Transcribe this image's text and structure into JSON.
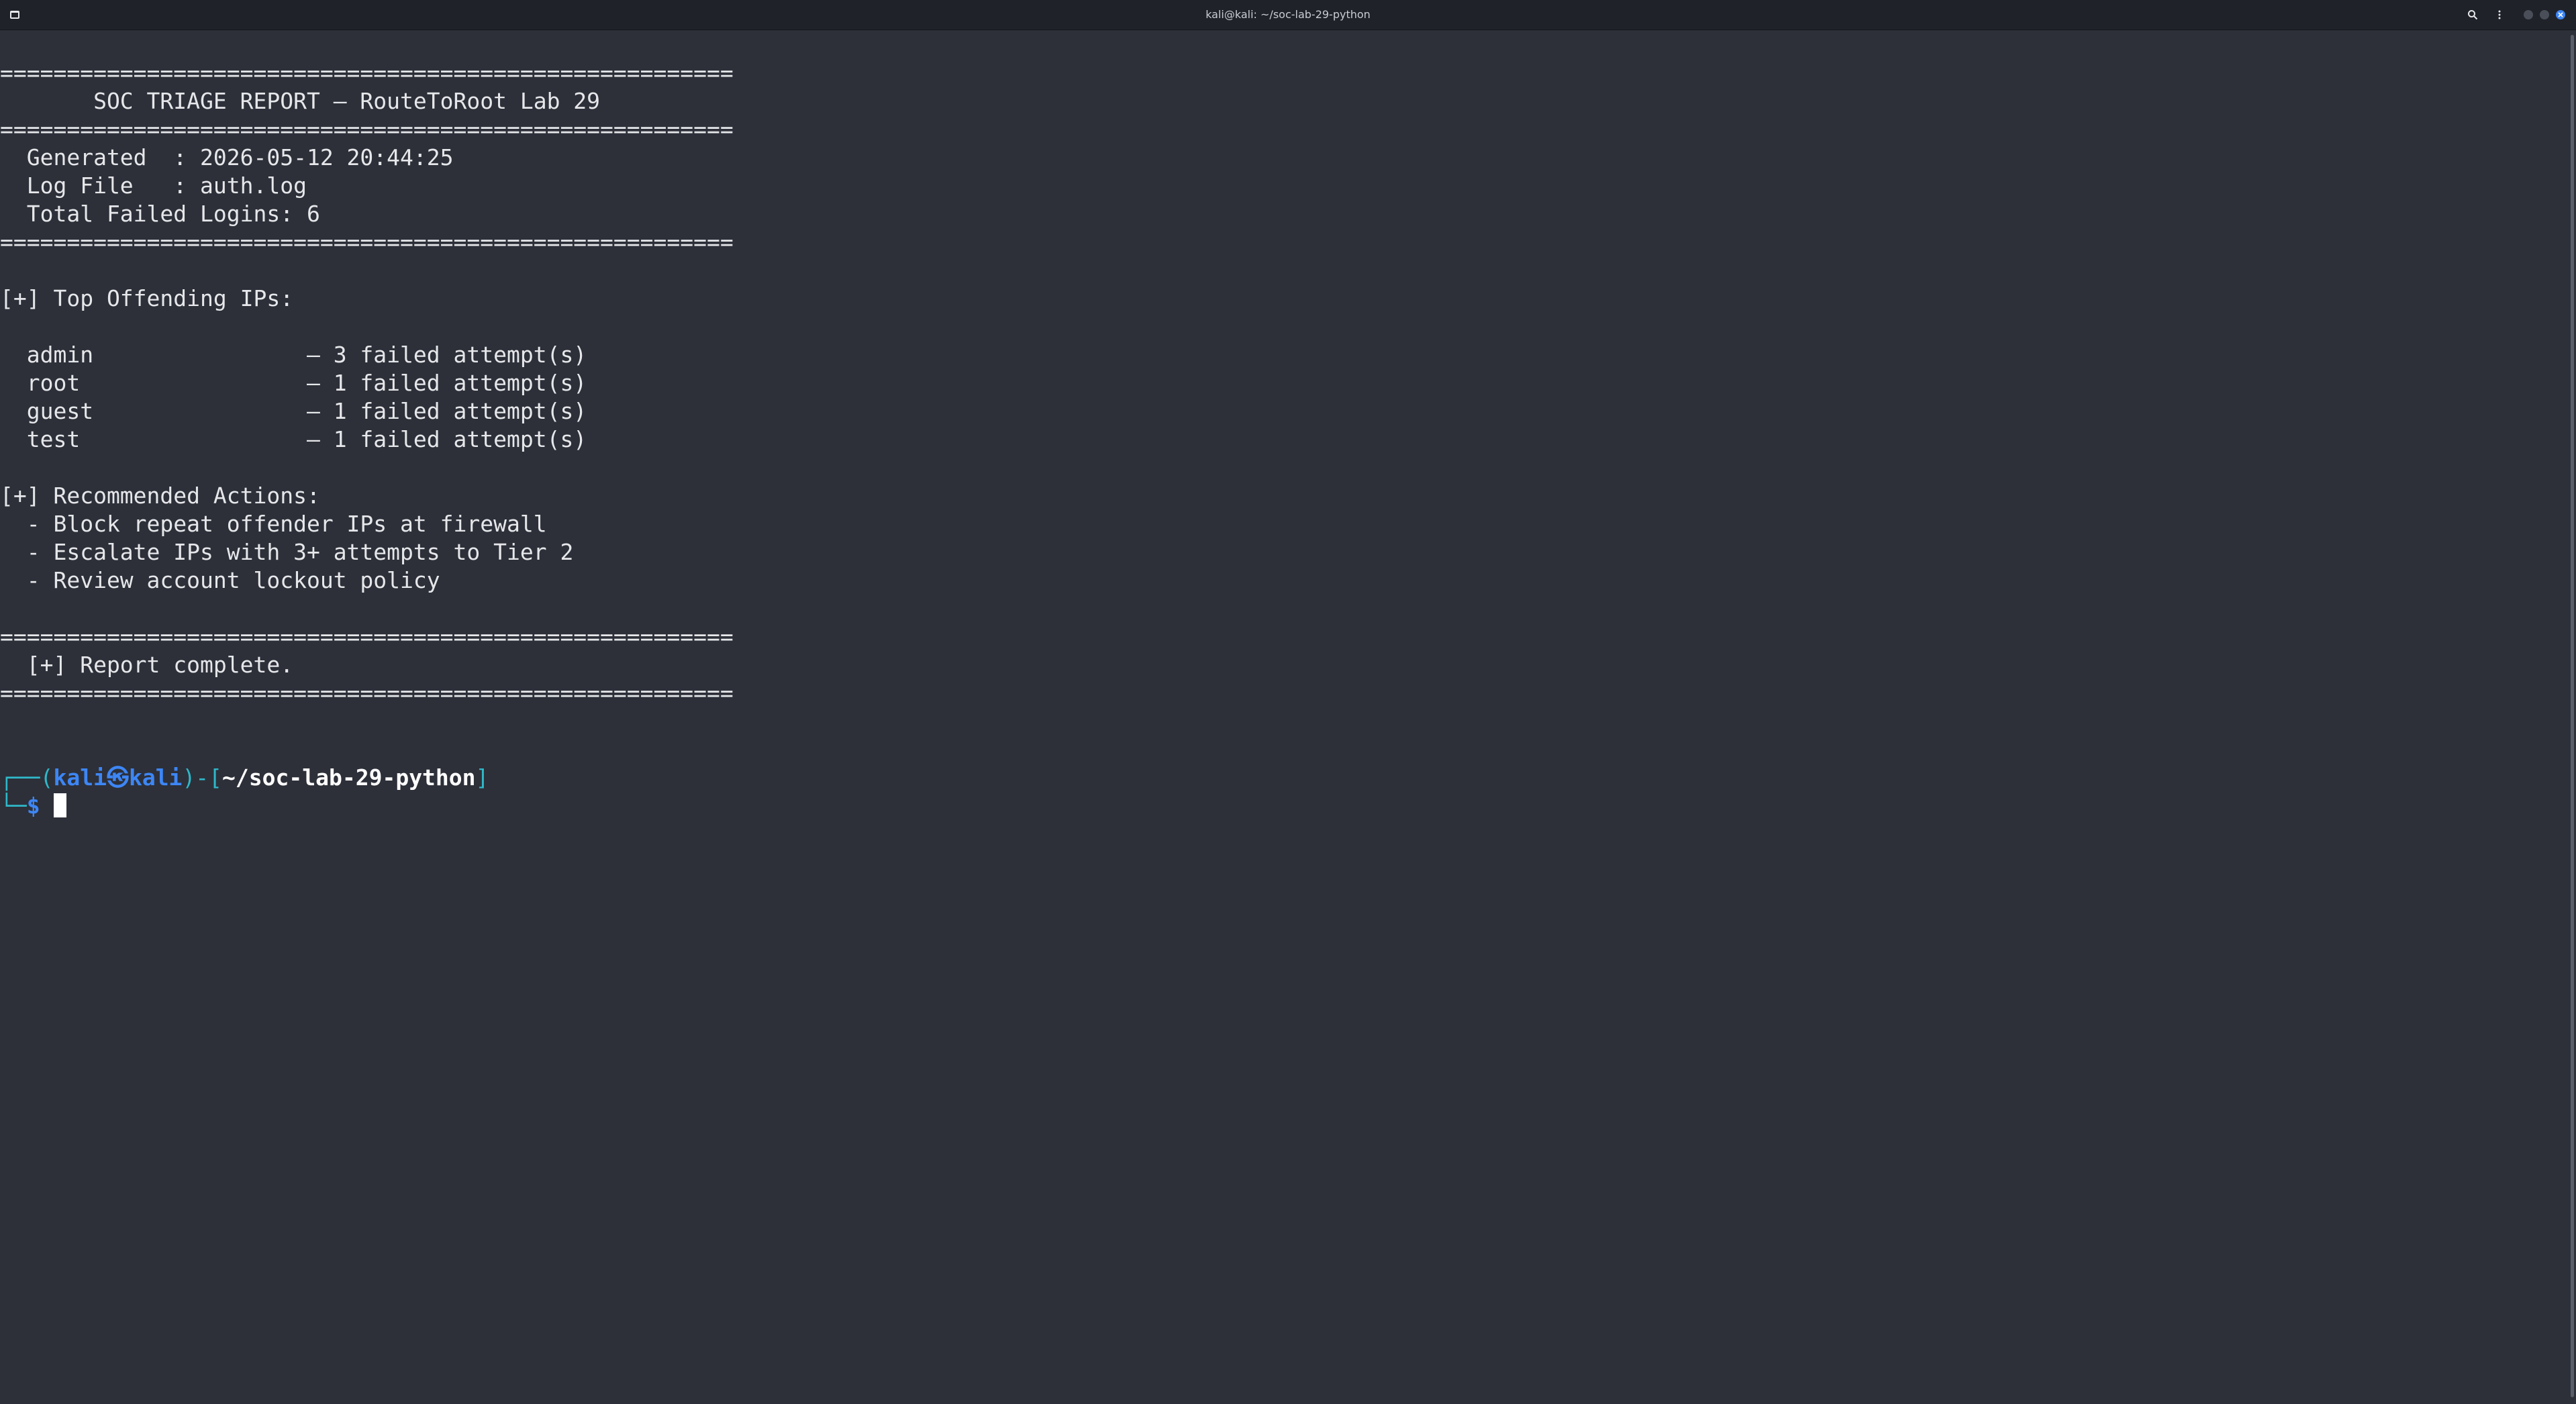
{
  "window": {
    "title": "kali@kali: ~/soc-lab-29-python"
  },
  "report": {
    "separator": "=======================================================",
    "title_line": "       SOC TRIAGE REPORT — RouteToRoot Lab 29",
    "generated": "  Generated  : 2026-05-12 20:44:25",
    "log_file": "  Log File   : auth.log",
    "total_failed": "  Total Failed Logins: 6",
    "offenders_heading": "[+] Top Offending IPs:",
    "offenders": [
      "  admin                — 3 failed attempt(s)",
      "  root                 — 1 failed attempt(s)",
      "  guest                — 1 failed attempt(s)",
      "  test                 — 1 failed attempt(s)"
    ],
    "actions_heading": "[+] Recommended Actions:",
    "actions": [
      "  - Block repeat offender IPs at firewall",
      "  - Escalate IPs with 3+ attempts to Tier 2",
      "  - Review account lockout policy"
    ],
    "complete": "  [+] Report complete."
  },
  "prompt": {
    "corner_top": "┌──(",
    "user_host": "kali㉿kali",
    "mid": ")-[",
    "path": "~/soc-lab-29-python",
    "close": "]",
    "corner_bottom": "└─",
    "dollar": "$ "
  },
  "icons": {
    "app": "terminal-app-icon",
    "search": "search-icon",
    "menu": "kebab-menu-icon",
    "minimize": "minimize-icon",
    "maximize": "maximize-icon",
    "close": "close-icon"
  },
  "colors": {
    "background": "#2d3039",
    "titlebar": "#1f2229",
    "text": "#e6e7ea",
    "prompt_frame": "#2fb8c9",
    "prompt_user": "#3d86f5"
  }
}
